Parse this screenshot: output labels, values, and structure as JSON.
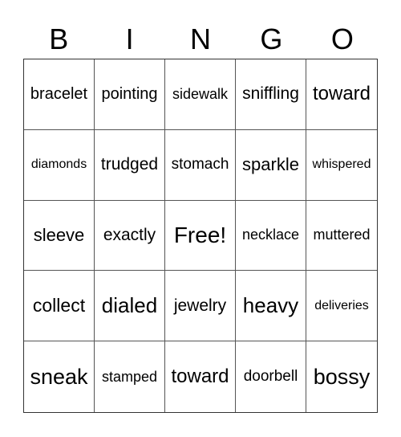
{
  "header": [
    "B",
    "I",
    "N",
    "G",
    "O"
  ],
  "cells": [
    "bracelet",
    "pointing",
    "sidewalk",
    "sniffling",
    "toward",
    "diamonds",
    "trudged",
    "stomach",
    "sparkle",
    "whispered",
    "sleeve",
    "exactly",
    "Free!",
    "necklace",
    "muttered",
    "collect",
    "dialed",
    "jewelry",
    "heavy",
    "deliveries",
    "sneak",
    "stamped",
    "toward",
    "doorbell",
    "bossy"
  ]
}
